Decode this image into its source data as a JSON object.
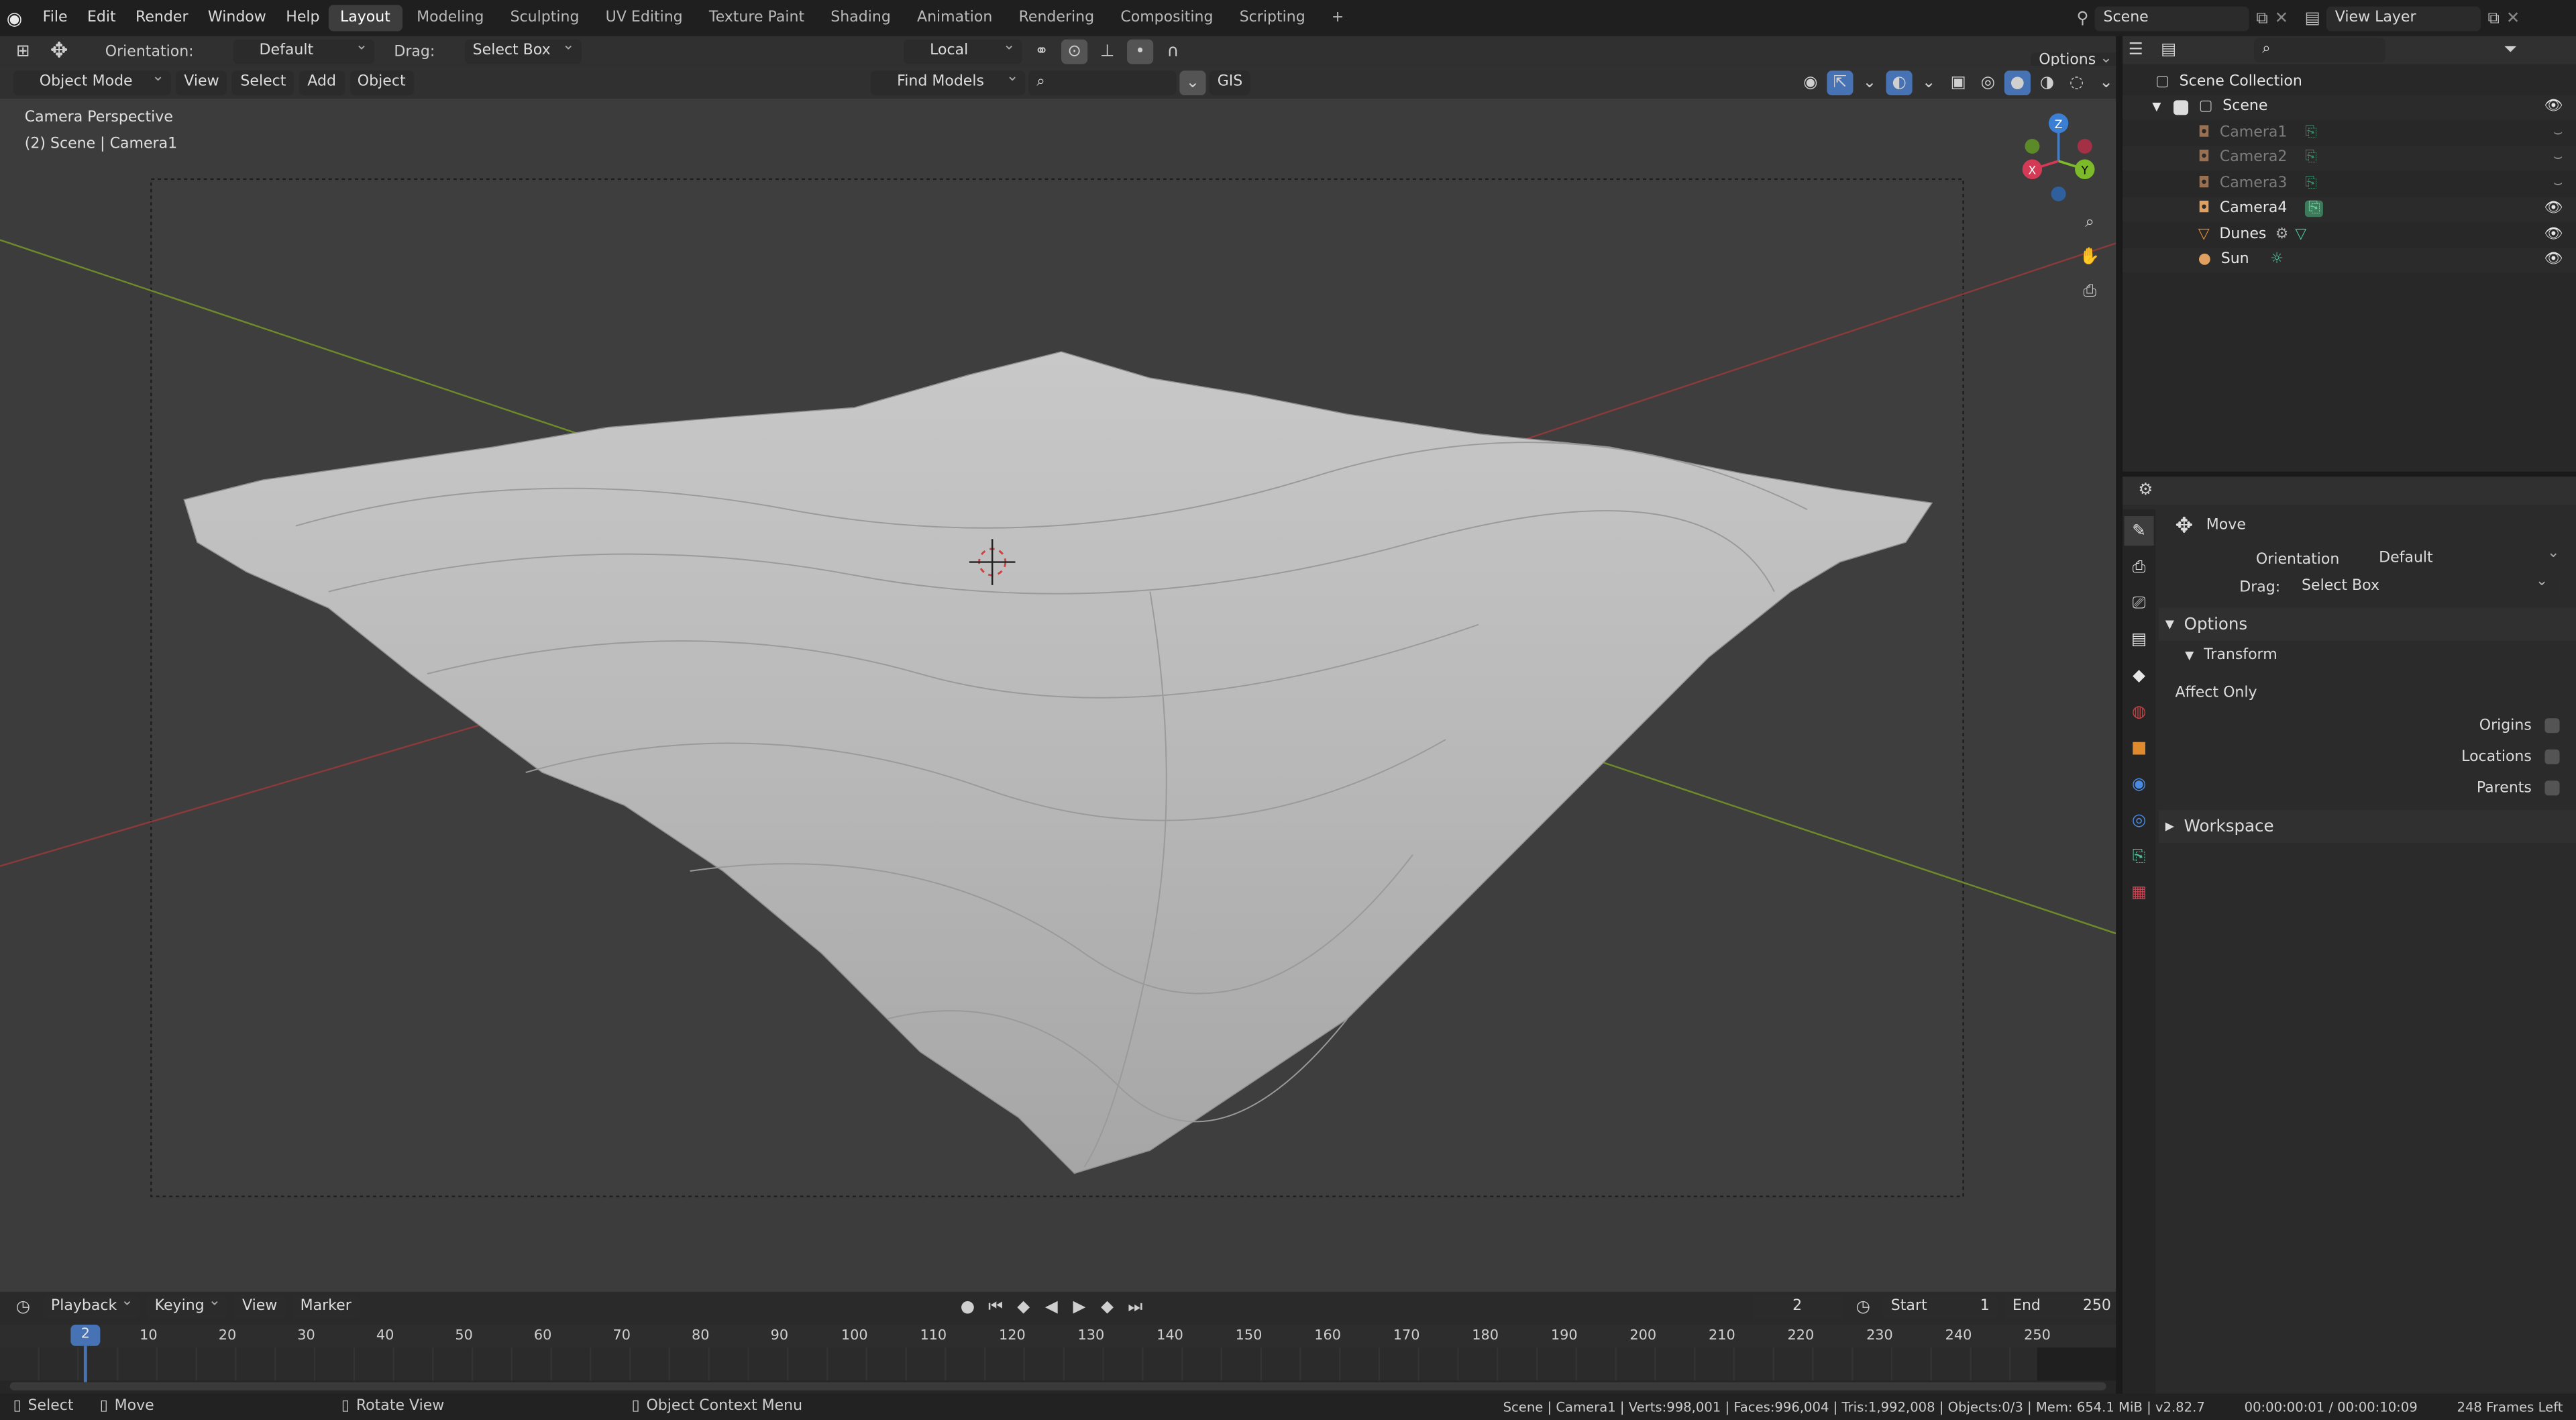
{
  "menu": [
    "File",
    "Edit",
    "Render",
    "Window",
    "Help"
  ],
  "workspaces": [
    "Layout",
    "Modeling",
    "Sculpting",
    "UV Editing",
    "Texture Paint",
    "Shading",
    "Animation",
    "Rendering",
    "Compositing",
    "Scripting"
  ],
  "workspace_add": "+",
  "scene_name": "Scene",
  "view_layer": "View Layer",
  "tool_header": {
    "orientation_label": "Orientation:",
    "orientation_value": "Default",
    "drag_label": "Drag:",
    "drag_value": "Select Box",
    "pivot_value": "Local",
    "options_label": "Options"
  },
  "viewport_header": {
    "mode": "Object Mode",
    "menus": [
      "View",
      "Select",
      "Add",
      "Object"
    ],
    "find_models": "Find Models",
    "gis": "GIS"
  },
  "viewport": {
    "perspective_label": "Camera Perspective",
    "scene_label": "(2) Scene | Camera1",
    "gizmo_axes": [
      "X",
      "Y",
      "Z"
    ]
  },
  "outliner": {
    "collection": "Scene Collection",
    "scene": "Scene",
    "items": [
      {
        "name": "Camera1",
        "dim": true
      },
      {
        "name": "Camera2",
        "dim": true
      },
      {
        "name": "Camera3",
        "dim": true
      },
      {
        "name": "Camera4",
        "dim": false
      },
      {
        "name": "Dunes",
        "dim": false
      },
      {
        "name": "Sun",
        "dim": false
      }
    ]
  },
  "properties": {
    "tool_name": "Move",
    "orientation_label": "Orientation",
    "orientation_value": "Default",
    "drag_label": "Drag:",
    "drag_value": "Select Box",
    "options_header": "Options",
    "transform_header": "Transform",
    "affect_only": "Affect Only",
    "checkboxes": [
      "Origins",
      "Locations",
      "Parents"
    ],
    "workspace_header": "Workspace"
  },
  "timeline": {
    "menus": [
      "Playback",
      "Keying",
      "View",
      "Marker"
    ],
    "current_frame": "2",
    "start_label": "Start",
    "start_value": "1",
    "end_label": "End",
    "end_value": "250",
    "ticks": [
      "10",
      "20",
      "30",
      "40",
      "50",
      "60",
      "70",
      "80",
      "90",
      "100",
      "110",
      "120",
      "130",
      "140",
      "150",
      "160",
      "170",
      "180",
      "190",
      "200",
      "210",
      "220",
      "230",
      "240",
      "250"
    ],
    "playhead_label": "2"
  },
  "statusbar": {
    "select": "Select",
    "move": "Move",
    "rotate": "Rotate View",
    "context": "Object Context Menu",
    "stats": "Scene | Camera1 | Verts:998,001 | Faces:996,004 | Tris:1,992,008 | Objects:0/3 | Mem: 654.1 MiB | v2.82.7",
    "time": "00:00:00:01 / 00:00:10:09",
    "frames_left": "248 Frames Left"
  },
  "colors": {
    "accent": "#4772b3",
    "active_tab": "#3d3d3d",
    "x_axis": "#d43a55",
    "y_axis": "#7cba29",
    "z_axis": "#3a7fd4",
    "camera_icon": "#e0a060",
    "mesh_icon": "#e08a30"
  }
}
